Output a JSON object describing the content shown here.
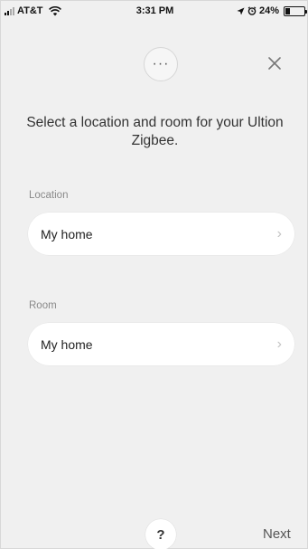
{
  "status_bar": {
    "carrier": "AT&T",
    "time": "3:31 PM",
    "battery_percent": "24%",
    "battery_level": 0.24,
    "icons": [
      "signal-icon",
      "wifi-icon",
      "location-arrow-icon",
      "alarm-icon",
      "battery-icon"
    ]
  },
  "header": {
    "more_label": "···",
    "close_icon": "close-icon"
  },
  "main": {
    "heading": "Select a location and room for your Ultion Zigbee.",
    "location": {
      "label": "Location",
      "value": "My home"
    },
    "room": {
      "label": "Room",
      "value": "My home"
    }
  },
  "footer": {
    "help_label": "?",
    "next_label": "Next"
  },
  "colors": {
    "background": "#f0f0f0",
    "card": "#ffffff",
    "label": "#8a8a8a",
    "chevron": "#c4c4c4"
  }
}
